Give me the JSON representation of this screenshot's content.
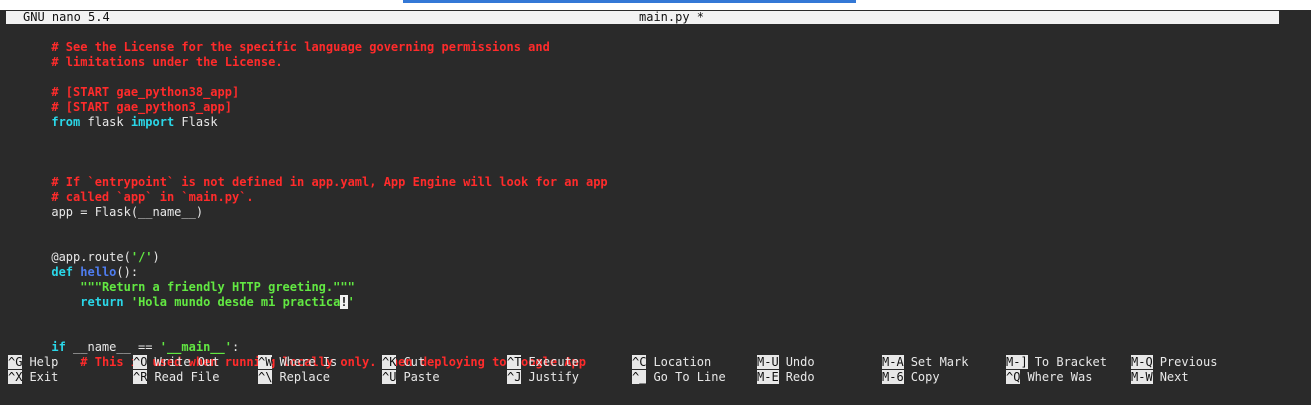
{
  "titlebar": {
    "app": "GNU nano 5.4",
    "file": "main.py *"
  },
  "editor": {
    "lines": {
      "l01": "# See the License for the specific language governing permissions and",
      "l02": "# limitations under the License.",
      "l04": "# [START gae_python38_app]",
      "l05": "# [START gae_python3_app]",
      "l06": {
        "from": "from",
        "mod": " flask ",
        "import": "import",
        "name": " Flask"
      },
      "l09": "# If `entrypoint` is not defined in app.yaml, App Engine will look for an app",
      "l10": "# called `app` in `main.py`.",
      "l11": "app = Flask(__name__)",
      "l14": {
        "deco": "@app.route(",
        "arg": "'/'",
        "close": ")"
      },
      "l15": {
        "def": "def",
        "sp": " ",
        "fname": "hello",
        "rest": "():"
      },
      "l16": {
        "indent": "    ",
        "doc": "\"\"\"Return a friendly HTTP greeting.\"\"\""
      },
      "l17": {
        "indent": "    ",
        "ret": "return",
        "sp": " ",
        "str1": "'Hola mundo desde mi practica",
        "cur": "!",
        "str2": "'"
      },
      "l20": {
        "if": "if",
        "cond": " __name__ == ",
        "str": "'__main__'",
        "colon": ":"
      },
      "l21": {
        "indent": "    ",
        "cm": "# This is used when running locally only. When deploying to Google App"
      }
    }
  },
  "shortcuts": [
    [
      {
        "key": "^G",
        "label": "Help"
      },
      {
        "key": "^X",
        "label": "Exit"
      }
    ],
    [
      {
        "key": "^O",
        "label": "Write Out"
      },
      {
        "key": "^R",
        "label": "Read File"
      }
    ],
    [
      {
        "key": "^W",
        "label": "Where Is"
      },
      {
        "key": "^\\",
        "label": "Replace"
      }
    ],
    [
      {
        "key": "^K",
        "label": "Cut"
      },
      {
        "key": "^U",
        "label": "Paste"
      }
    ],
    [
      {
        "key": "^T",
        "label": "Execute"
      },
      {
        "key": "^J",
        "label": "Justify"
      }
    ],
    [
      {
        "key": "^C",
        "label": "Location"
      },
      {
        "key": "^_",
        "label": "Go To Line"
      }
    ],
    [
      {
        "key": "M-U",
        "label": "Undo"
      },
      {
        "key": "M-E",
        "label": "Redo"
      }
    ],
    [
      {
        "key": "M-A",
        "label": "Set Mark"
      },
      {
        "key": "M-6",
        "label": "Copy"
      }
    ],
    [
      {
        "key": "M-]",
        "label": "To Bracket"
      },
      {
        "key": "^Q",
        "label": "Where Was"
      }
    ],
    [
      {
        "key": "M-Q",
        "label": "Previous"
      },
      {
        "key": "M-W",
        "label": "Next"
      }
    ]
  ],
  "colors": {
    "comment": "#ff2b2b",
    "keyword": "#2ad7e8",
    "function": "#4f7df0",
    "string": "#62e842",
    "background": "#2a2a2a",
    "text": "#e8e8e8"
  }
}
